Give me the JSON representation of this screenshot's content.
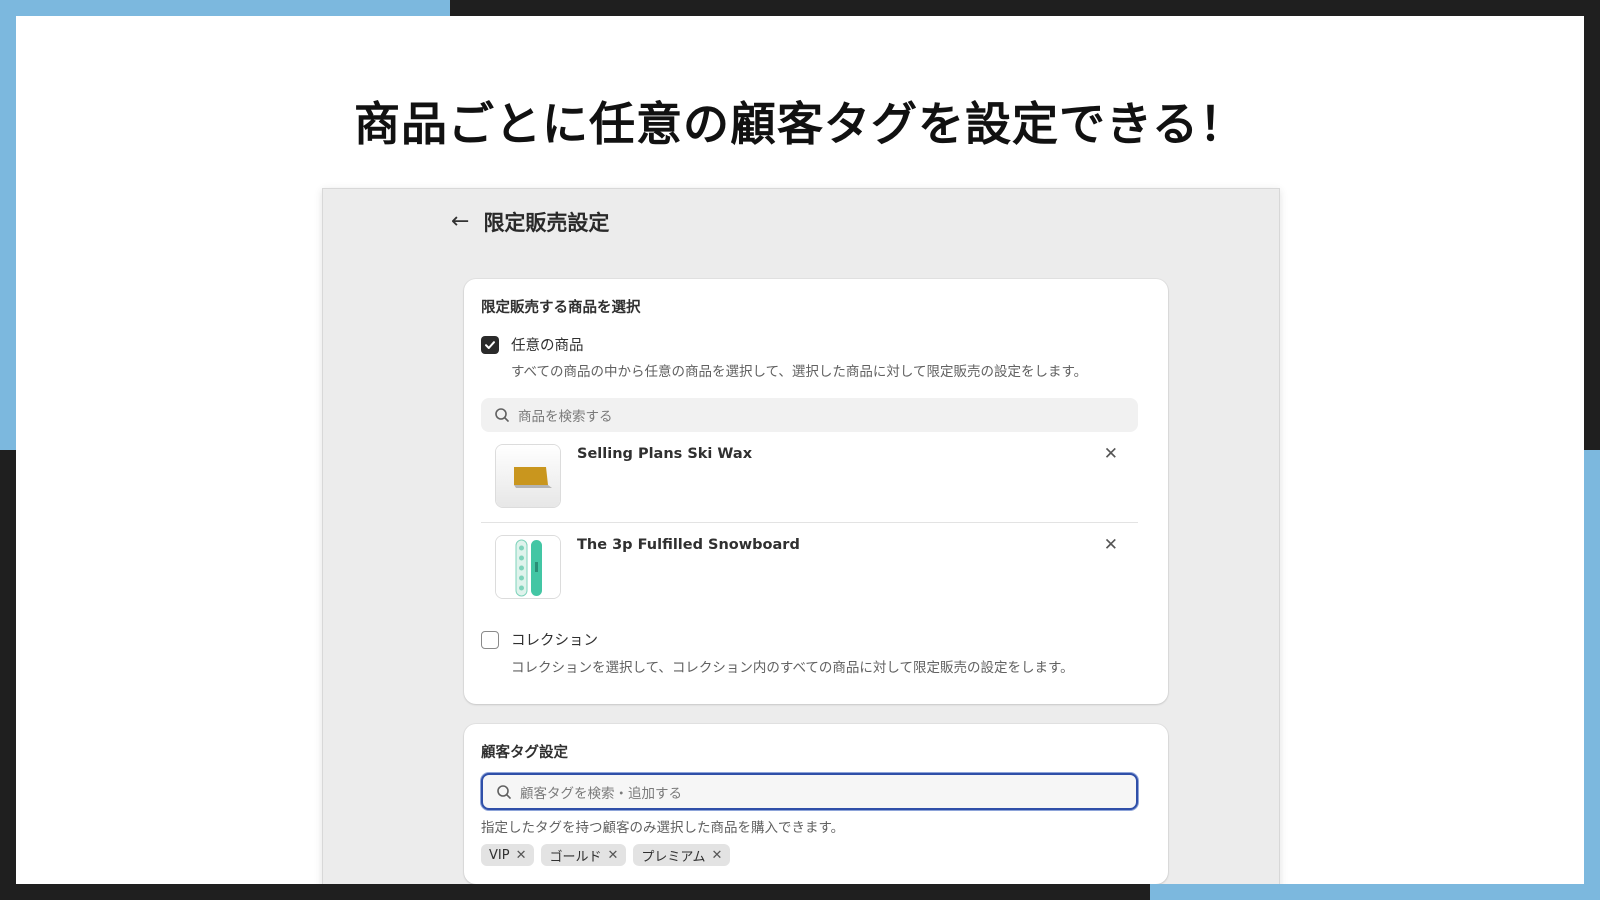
{
  "headline": "商品ごとに任意の顧客タグを設定できる！",
  "page": {
    "title": "限定販売設定"
  },
  "products_card": {
    "heading": "限定販売する商品を選択",
    "any_products": {
      "label": "任意の商品",
      "checked": true,
      "help": "すべての商品の中から任意の商品を選択して、選択した商品に対して限定販売の設定をします。"
    },
    "search_placeholder": "商品を検索する",
    "products": [
      {
        "name": "Selling Plans Ski Wax",
        "thumb": "ski-wax"
      },
      {
        "name": "The 3p Fulfilled Snowboard",
        "thumb": "snowboard"
      }
    ],
    "collection": {
      "label": "コレクション",
      "checked": false,
      "help": "コレクションを選択して、コレクション内のすべての商品に対して限定販売の設定をします。"
    }
  },
  "tags_card": {
    "heading": "顧客タグ設定",
    "search_placeholder": "顧客タグを検索・追加する",
    "help": "指定したタグを持つ顧客のみ選択した商品を購入できます。",
    "tags": [
      "VIP",
      "ゴールド",
      "プレミアム"
    ]
  },
  "icons": {
    "back": "arrow-left-icon",
    "search": "search-icon",
    "remove": "close-icon",
    "check": "checkmark-icon"
  },
  "colors": {
    "accent_blue": "#7cb8de",
    "frame_dark": "#1f1f1f",
    "focus_border": "#2f4fa8"
  }
}
